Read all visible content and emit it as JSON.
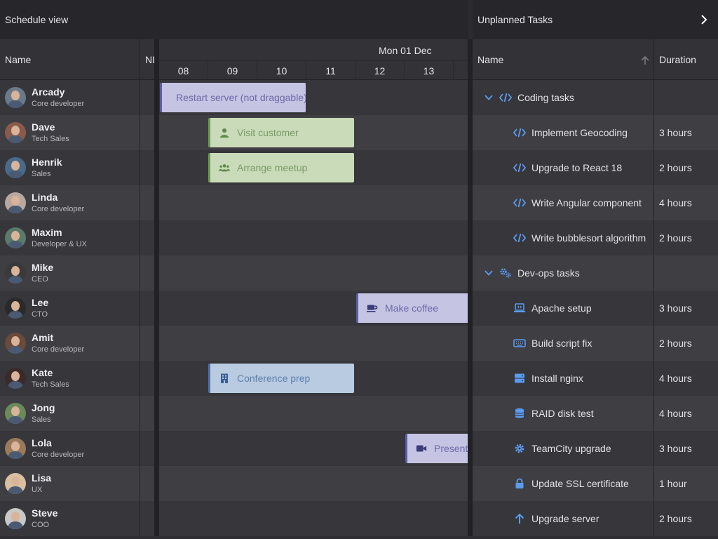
{
  "header": {
    "schedule_title": "Schedule view",
    "unplanned_title": "Unplanned Tasks"
  },
  "locked_columns": {
    "name": "Name",
    "nl": "NI"
  },
  "timeline": {
    "date": "Mon 01 Dec",
    "hours": [
      "08",
      "09",
      "10",
      "11",
      "12",
      "13",
      ""
    ]
  },
  "resources": [
    {
      "name": "Arcady",
      "role": "Core developer",
      "avatar_color": "#6b7a8a"
    },
    {
      "name": "Dave",
      "role": "Tech Sales",
      "avatar_color": "#8a5a4a"
    },
    {
      "name": "Henrik",
      "role": "Sales",
      "avatar_color": "#4a6a8a"
    },
    {
      "name": "Linda",
      "role": "Core developer",
      "avatar_color": "#b8a8a0"
    },
    {
      "name": "Maxim",
      "role": "Developer & UX",
      "avatar_color": "#5a7a6a"
    },
    {
      "name": "Mike",
      "role": "CEO",
      "avatar_color": "#3a3a3a"
    },
    {
      "name": "Lee",
      "role": "CTO",
      "avatar_color": "#2a2a2a"
    },
    {
      "name": "Amit",
      "role": "Core developer",
      "avatar_color": "#6a4a3a"
    },
    {
      "name": "Kate",
      "role": "Tech Sales",
      "avatar_color": "#3a2a2a"
    },
    {
      "name": "Jong",
      "role": "Sales",
      "avatar_color": "#6a8a5a"
    },
    {
      "name": "Lola",
      "role": "Core developer",
      "avatar_color": "#9a7a5a"
    },
    {
      "name": "Lisa",
      "role": "UX",
      "avatar_color": "#d8c0a0"
    },
    {
      "name": "Steve",
      "role": "COO",
      "avatar_color": "#c8c8c8"
    }
  ],
  "events": [
    {
      "label": "Restart server (not draggable)",
      "row": 0,
      "style": "lav",
      "icon": "none"
    },
    {
      "label": "Visit customer",
      "row": 1,
      "style": "green",
      "icon": "user-icon"
    },
    {
      "label": "Arrange meetup",
      "row": 2,
      "style": "green",
      "icon": "users-icon"
    },
    {
      "label": "Make coffee",
      "row": 6,
      "style": "lav",
      "icon": "coffee-icon"
    },
    {
      "label": "Conference prep",
      "row": 8,
      "style": "blue",
      "icon": "building-icon"
    },
    {
      "label": "Presenta",
      "row": 10,
      "style": "lav",
      "icon": "video-icon"
    }
  ],
  "unplanned": {
    "columns": {
      "name": "Name",
      "duration": "Duration"
    },
    "rows": [
      {
        "type": "group",
        "name": "Coding tasks",
        "icon": "code-icon",
        "duration": ""
      },
      {
        "type": "task",
        "name": "Implement Geocoding",
        "icon": "code-icon",
        "duration": "3 hours"
      },
      {
        "type": "task",
        "name": "Upgrade to React 18",
        "icon": "code-icon",
        "duration": "2 hours"
      },
      {
        "type": "task",
        "name": "Write Angular component",
        "icon": "code-icon",
        "duration": "4 hours"
      },
      {
        "type": "task",
        "name": "Write bubblesort algorithm",
        "icon": "code-icon",
        "duration": "2 hours"
      },
      {
        "type": "group",
        "name": "Dev-ops tasks",
        "icon": "cogs-icon",
        "duration": ""
      },
      {
        "type": "task",
        "name": "Apache setup",
        "icon": "laptop-code-icon",
        "duration": "3 hours"
      },
      {
        "type": "task",
        "name": "Build script fix",
        "icon": "keyboard-icon",
        "duration": "2 hours"
      },
      {
        "type": "task",
        "name": "Install nginx",
        "icon": "server-icon",
        "duration": "4 hours"
      },
      {
        "type": "task",
        "name": "RAID disk test",
        "icon": "database-icon",
        "duration": "4 hours"
      },
      {
        "type": "task",
        "name": "TeamCity upgrade",
        "icon": "gear-icon",
        "duration": "3 hours"
      },
      {
        "type": "task",
        "name": "Update SSL certificate",
        "icon": "lock-icon",
        "duration": "1 hour"
      },
      {
        "type": "task",
        "name": "Upgrade server",
        "icon": "arrow-up-icon",
        "duration": "2 hours"
      }
    ]
  },
  "colors": {
    "accent": "#5b9bf0",
    "background": "#2b2b30"
  }
}
